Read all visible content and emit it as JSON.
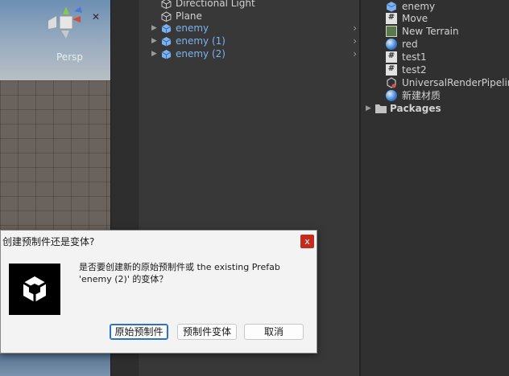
{
  "scene": {
    "persp_label": "Persp",
    "close_glyph": "✕",
    "icons": [
      "scene-gizmo-icon"
    ]
  },
  "hierarchy": {
    "items": [
      {
        "label": "Directional Light",
        "type": "gameobject",
        "expandable": false
      },
      {
        "label": "Plane",
        "type": "gameobject",
        "expandable": false
      },
      {
        "label": "enemy",
        "type": "prefab",
        "expandable": true
      },
      {
        "label": "enemy (1)",
        "type": "prefab",
        "expandable": true
      },
      {
        "label": "enemy (2)",
        "type": "prefab",
        "expandable": true
      }
    ]
  },
  "project": {
    "items": [
      {
        "label": "enemy",
        "icon": "prefab-icon"
      },
      {
        "label": "Move",
        "icon": "script-icon"
      },
      {
        "label": "New Terrain",
        "icon": "terrain-icon"
      },
      {
        "label": "red",
        "icon": "material-icon"
      },
      {
        "label": "test1",
        "icon": "script-icon"
      },
      {
        "label": "test2",
        "icon": "script-icon"
      },
      {
        "label": "UniversalRenderPipeline",
        "icon": "pipeline-asset-icon"
      },
      {
        "label": "新建材质",
        "icon": "material-icon"
      }
    ],
    "packages_label": "Packages"
  },
  "dialog": {
    "title": "创建预制件还是变体?",
    "close_glyph": "x",
    "message_line1": "是否要创建新的原始预制件或 the existing Prefab",
    "message_line2": "'enemy (2)' 的变体？",
    "buttons": {
      "original": "原始预制件",
      "variant": "预制件变体",
      "cancel": "取消"
    }
  },
  "colors": {
    "prefab_text": "#7cb2f0",
    "dialog_close_bg": "#c42b1c",
    "panel_bg": "#383838",
    "focus_border": "#2a72c7"
  }
}
